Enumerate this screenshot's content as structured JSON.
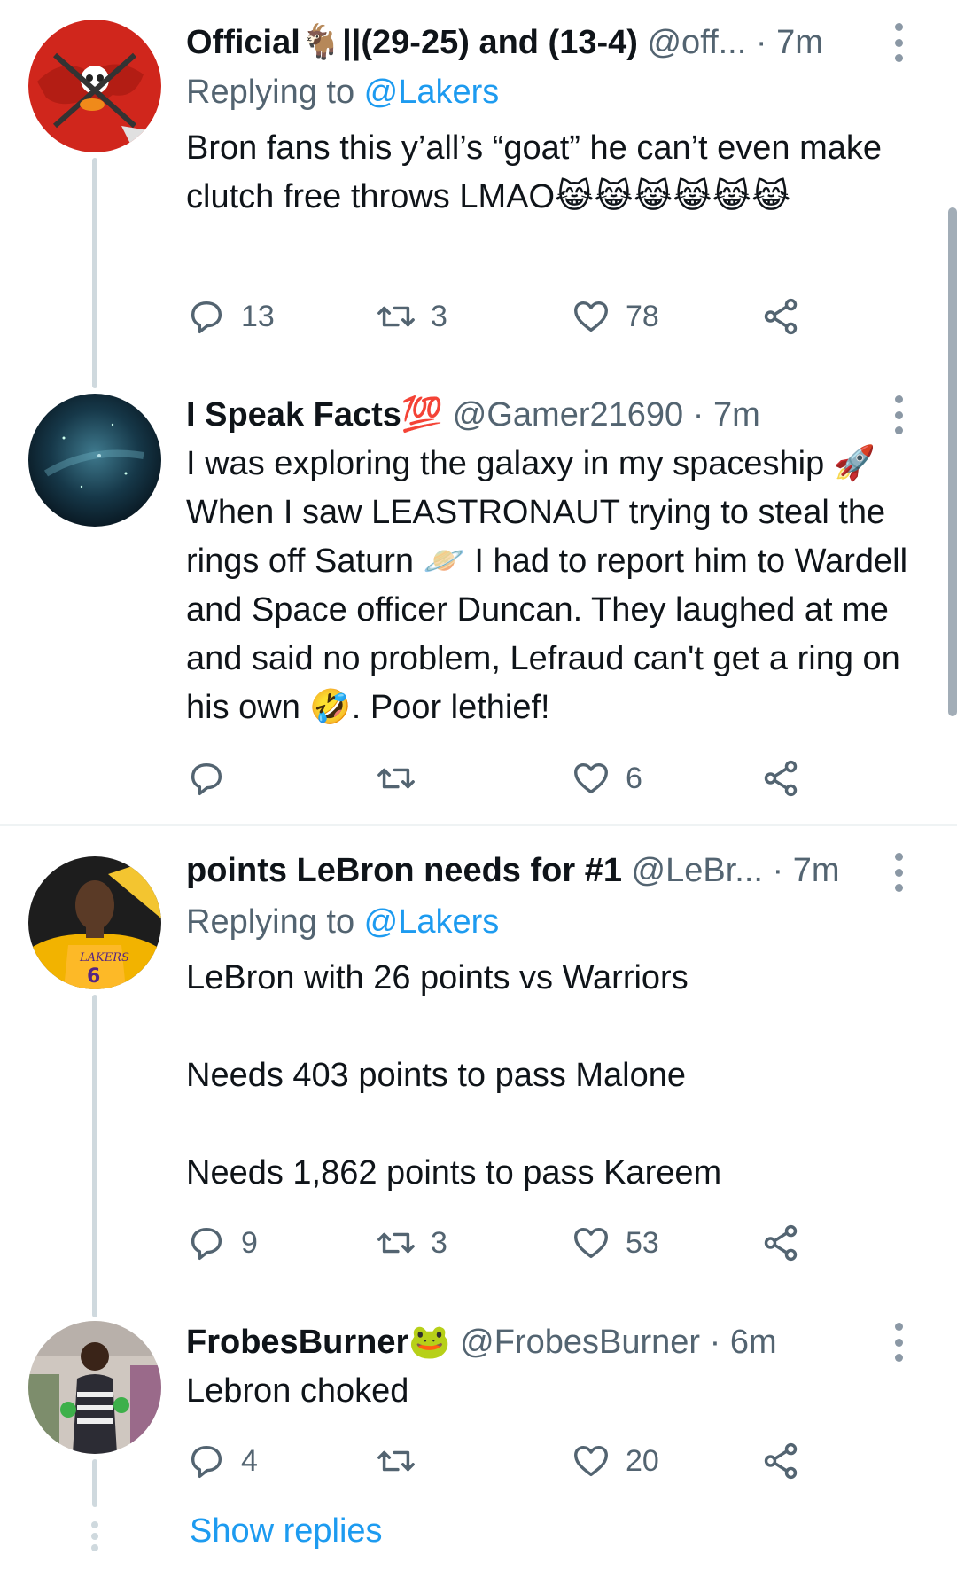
{
  "tweets": [
    {
      "name": "Official🐐||(29-25) and (13-4)",
      "handle": "@off...",
      "dot": " · ",
      "time": "7m",
      "replying_prefix": "Replying to ",
      "replying_to": "@Lakers",
      "text": "Bron fans this y’all’s “goat” he can’t even make clutch free throws LMAO😹😹😹😹😹😹",
      "replies": "13",
      "retweets": "3",
      "likes": "78"
    },
    {
      "name": "I Speak Facts💯",
      "handle": "@Gamer21690",
      "dot": " · ",
      "time": "7m",
      "text": "I was exploring the galaxy in my spaceship 🚀 When I saw LEASTRONAUT trying to steal the rings off Saturn 🪐 I had to report him to Wardell and Space officer Duncan. They laughed at me and said no problem, Lefraud can't get a ring on his own 🤣. Poor lethief!",
      "replies": "",
      "retweets": "",
      "likes": "6"
    },
    {
      "name": "points LeBron needs for #1",
      "handle": "@LeBr...",
      "dot": " · ",
      "time": "7m",
      "replying_prefix": "Replying to ",
      "replying_to": "@Lakers",
      "text": "LeBron with 26 points vs Warriors\n\nNeeds 403 points to pass Malone\n\nNeeds 1,862 points to pass Kareem",
      "replies": "9",
      "retweets": "3",
      "likes": "53"
    },
    {
      "name": "FrobesBurner🐸",
      "handle": "@FrobesBurner",
      "dot": " · ",
      "time": "6m",
      "text": "Lebron choked",
      "replies": "4",
      "retweets": "",
      "likes": "20"
    }
  ],
  "show_replies": "Show replies",
  "colors": {
    "accent": "#1d9bf0",
    "secondary_text": "#536471",
    "thread_line": "#cfd9de"
  },
  "icons": [
    "reply-icon",
    "retweet-icon",
    "like-icon",
    "share-icon",
    "more-icon"
  ]
}
